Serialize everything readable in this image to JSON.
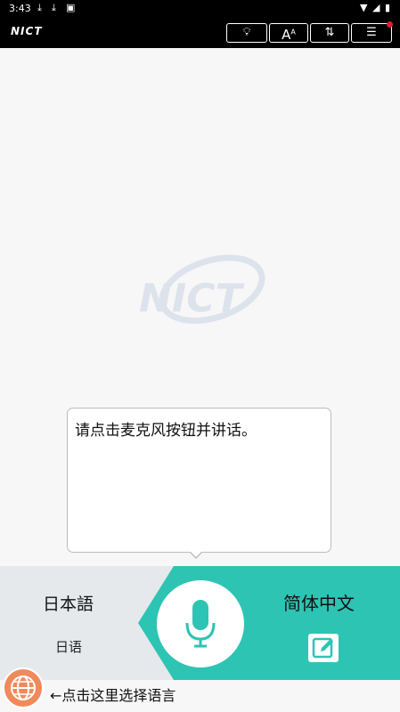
{
  "status_bar": {
    "time": "3:43"
  },
  "app_bar": {
    "logo_text": "NICT",
    "font_button_label": "A",
    "font_button_sup": "A"
  },
  "watermark_text": "NICT",
  "prompt": {
    "text": "请点击麦克风按钮并讲话。"
  },
  "source_language": {
    "name": "日本語",
    "sub": "日语"
  },
  "target_language": {
    "name": "简体中文"
  },
  "bottom_hint": "←点击这里选择语言",
  "colors": {
    "teal": "#2ec4b3",
    "left_bg": "#e6e9ec",
    "globe": "#f08a5a",
    "badge": "#e01b2f"
  },
  "icons": [
    "download-icon",
    "download-icon",
    "notification-icon",
    "wifi-icon",
    "battery-icon",
    "lightbulb-icon",
    "font-size-icon",
    "history-icon",
    "menu-icon",
    "microphone-icon",
    "edit-icon",
    "globe-icon"
  ]
}
